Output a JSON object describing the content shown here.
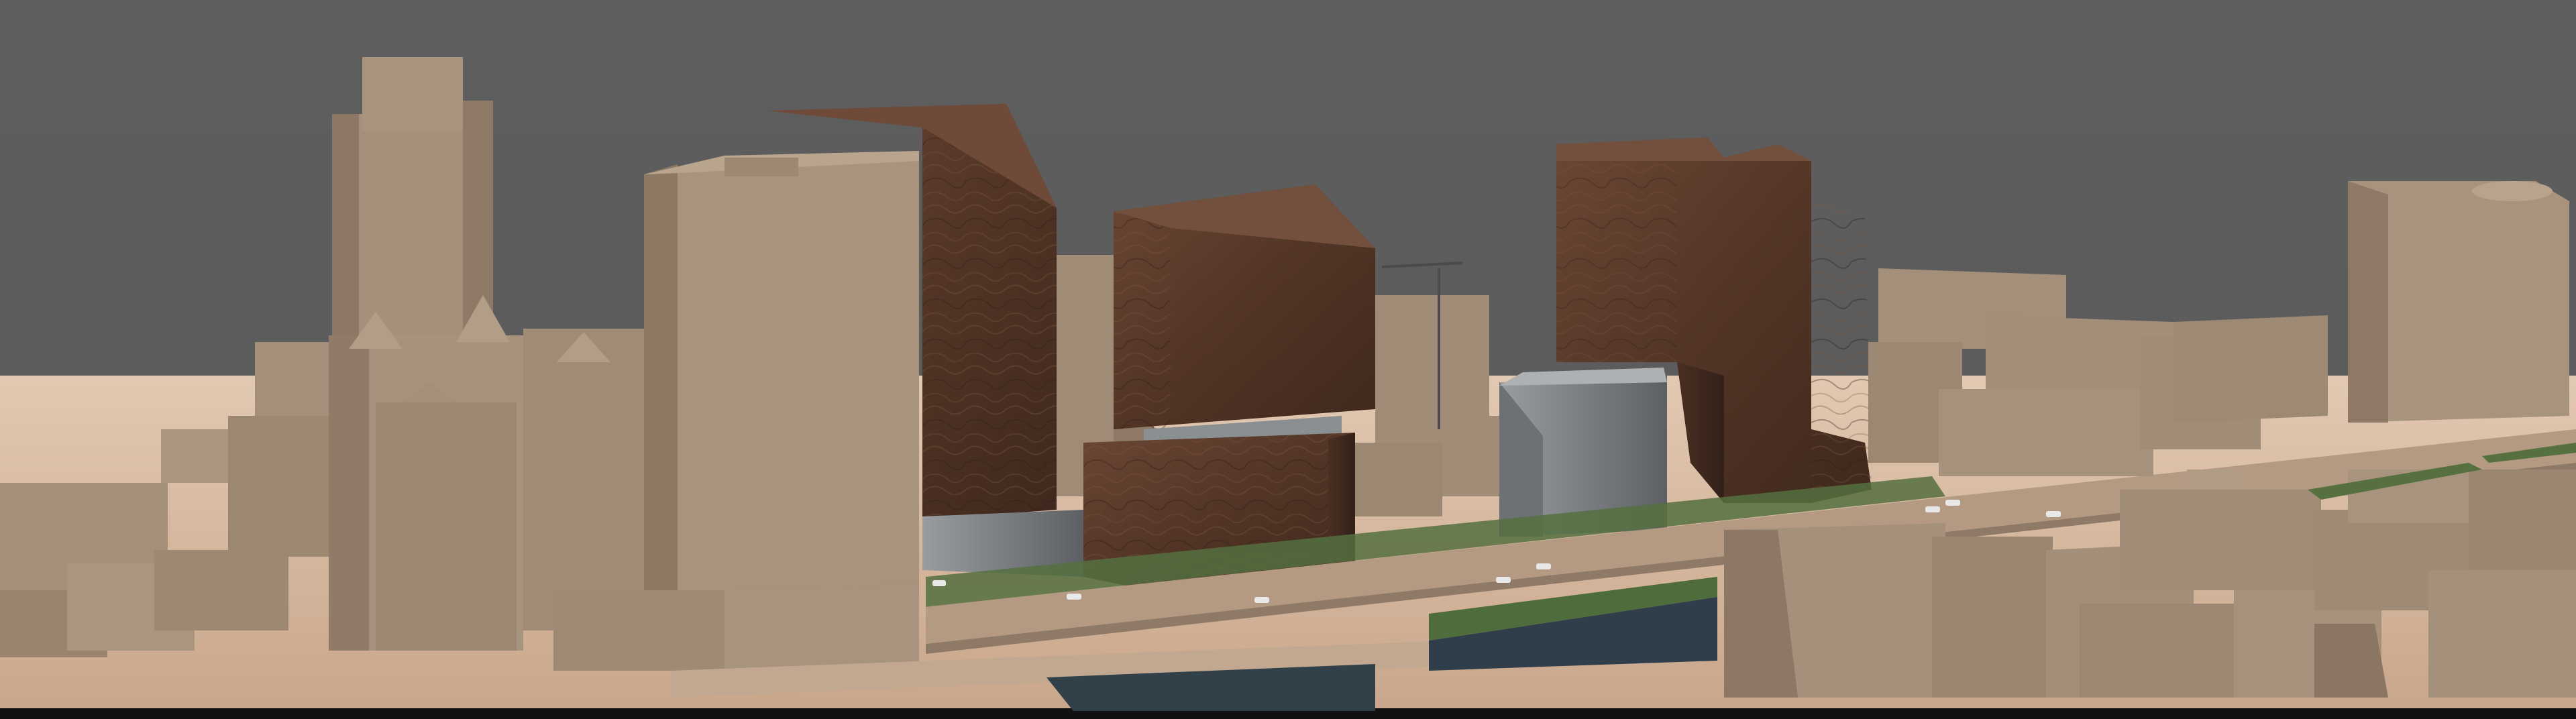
{
  "colors": {
    "sky": "#5d5d5d",
    "ground": "#d4b79e",
    "ground_dark": "#c9a98f",
    "block_light": "#a6927c",
    "block_mid": "#958069",
    "block_dark": "#7d6a57",
    "walnut": "#5a3b2c",
    "walnut_dark": "#3f2a1f",
    "walnut_light": "#6e4a37",
    "glass": "#8a8d90",
    "glass_dark": "#5f6366",
    "grass": "#4e6b3c",
    "water": "#2c3a46",
    "road": "#bda48d"
  }
}
